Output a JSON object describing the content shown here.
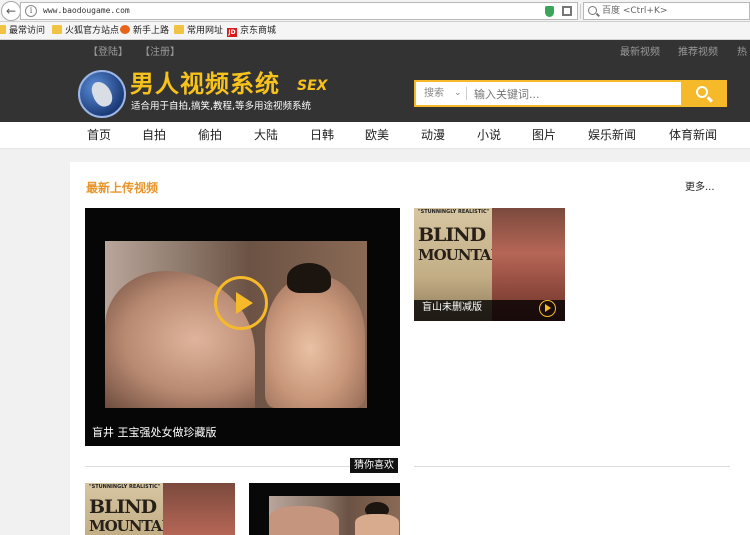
{
  "browser": {
    "url": "www.baodougame.com",
    "search_placeholder": "百度 <Ctrl+K>",
    "bookmarks": [
      "最常访问",
      "火狐官方站点",
      "新手上路",
      "常用网址",
      "京东商城"
    ]
  },
  "site": {
    "login": "【登陆】",
    "register": "【注册】",
    "top_links": [
      "最新视频",
      "推荐视频",
      "热"
    ],
    "logo_title": "男人视频系统",
    "logo_tag": "SEX",
    "logo_slogan": "适合用于自拍,搞笑,教程,等多用途视频系统",
    "search_select": "搜索",
    "search_placeholder": "输入关键词...",
    "nav": [
      "首页",
      "自拍",
      "偷拍",
      "大陆",
      "日韩",
      "欧美",
      "动漫",
      "小说",
      "图片",
      "娱乐新闻",
      "体育新闻"
    ]
  },
  "section": {
    "title": "最新上传视频",
    "more": "更多...",
    "featured_caption": "盲井 王宝强处女做珍藏版",
    "side_caption": "盲山未删减版",
    "guess": "猜你喜欢",
    "poster_top": "\"STUNNINGLY REALISTIC\"",
    "poster_word1": "BLIND",
    "poster_word2": "MOUNTAIN"
  },
  "colors": {
    "accent": "#f5b92a",
    "title_orange": "#e8952b",
    "header_bg": "#333333"
  }
}
